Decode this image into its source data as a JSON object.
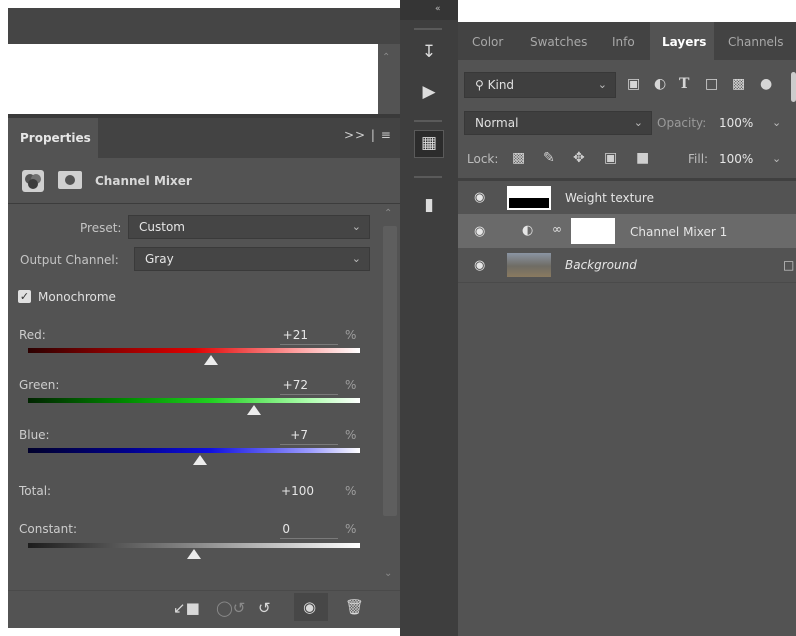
{
  "properties": {
    "title": "Properties",
    "adjustment_name": "Channel Mixer",
    "preset_label": "Preset:",
    "preset_value": "Custom",
    "output_channel_label": "Output Channel:",
    "output_channel_value": "Gray",
    "monochrome_label": "Monochrome",
    "monochrome_checked": true,
    "sliders": {
      "red": {
        "label": "Red:",
        "value": "+21",
        "unit": "%",
        "level_percent": 21
      },
      "green": {
        "label": "Green:",
        "value": "+72",
        "unit": "%",
        "level_percent": 72
      },
      "blue": {
        "label": "Blue:",
        "value": "+7",
        "unit": "%",
        "level_percent": 7
      }
    },
    "total": {
      "label": "Total:",
      "value": "+100",
      "unit": "%"
    },
    "constant": {
      "label": "Constant:",
      "value": "0",
      "unit": "%",
      "level_percent": 0
    }
  },
  "layers_panel": {
    "tabs": [
      "Color",
      "Swatches",
      "Info",
      "Layers",
      "Channels"
    ],
    "active_tab": "Layers",
    "filter_kind": "Kind",
    "blend_mode": "Normal",
    "opacity_label": "Opacity:",
    "opacity_value": "100%",
    "lock_label": "Lock:",
    "fill_label": "Fill:",
    "fill_value": "100%",
    "layers": [
      {
        "name": "Weight texture",
        "visible": true
      },
      {
        "name": "Channel Mixer 1",
        "visible": true,
        "selected": true
      },
      {
        "name": "Background",
        "visible": true,
        "locked": true
      }
    ]
  },
  "icons": {
    "props_footer": [
      "clip-to-layer-icon",
      "view-previous-state-icon",
      "reset-icon",
      "toggle-visibility-icon",
      "delete-icon"
    ],
    "middle_toolbar": [
      "history-icon",
      "actions-play-icon",
      "properties-panel-icon",
      "paths-icon"
    ]
  },
  "colors": {
    "panel_bg": "#535353",
    "header_bg": "#434343",
    "selected_row": "#6a6a6a"
  }
}
